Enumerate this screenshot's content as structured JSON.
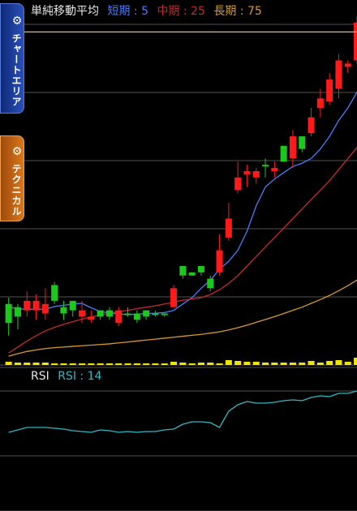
{
  "legend": {
    "title": "単純移動平均",
    "short": "短期 : 5",
    "mid": "中期 : 25",
    "long": "長期 : 75"
  },
  "rsi_legend": {
    "title": "RSI",
    "period": "RSI : 14"
  },
  "tabs": {
    "chart_area": "チャートエリア",
    "technical": "テクニカル"
  },
  "icons": {
    "tab_gear": "gear-icon"
  },
  "colors": {
    "up": "#1dc81d",
    "down": "#ff1a1a",
    "sma_short": "#4a7cff",
    "sma_mid": "#c62a2a",
    "sma_long": "#d79a2a",
    "rsi": "#35b7c0",
    "volume": "#f2e600",
    "price_line": "#f5b26b",
    "grid": "#505050"
  },
  "chart_data": [
    {
      "type": "candlestick",
      "title": "単純移動平均",
      "series_names": [
        "短期 : 5",
        "中期 : 25",
        "長期 : 75"
      ],
      "price_range": [
        0,
        100
      ],
      "grid": true,
      "candles": [
        {
          "o": 12,
          "h": 20,
          "l": 8,
          "c": 18
        },
        {
          "o": 14,
          "h": 18,
          "l": 10,
          "c": 17
        },
        {
          "o": 19,
          "h": 22,
          "l": 14,
          "c": 16
        },
        {
          "o": 19,
          "h": 21,
          "l": 13,
          "c": 16
        },
        {
          "o": 18,
          "h": 23,
          "l": 13,
          "c": 15
        },
        {
          "o": 19,
          "h": 25,
          "l": 18,
          "c": 24
        },
        {
          "o": 15,
          "h": 19,
          "l": 13,
          "c": 17
        },
        {
          "o": 16,
          "h": 19,
          "l": 14,
          "c": 19
        },
        {
          "o": 16,
          "h": 19,
          "l": 12,
          "c": 14
        },
        {
          "o": 14,
          "h": 16,
          "l": 12,
          "c": 13
        },
        {
          "o": 14,
          "h": 16,
          "l": 13,
          "c": 16
        },
        {
          "o": 14,
          "h": 17,
          "l": 13,
          "c": 16
        },
        {
          "o": 16,
          "h": 17,
          "l": 11,
          "c": 12
        },
        {
          "o": 15,
          "h": 17,
          "l": 14,
          "c": 15
        },
        {
          "o": 13,
          "h": 16,
          "l": 12,
          "c": 15
        },
        {
          "o": 14,
          "h": 16,
          "l": 13,
          "c": 16
        },
        {
          "o": 15,
          "h": 16,
          "l": 14,
          "c": 15
        },
        {
          "o": 15,
          "h": 15,
          "l": 14,
          "c": 15
        },
        {
          "o": 23,
          "h": 24,
          "l": 17,
          "c": 17
        },
        {
          "o": 27,
          "h": 30,
          "l": 26,
          "c": 30
        },
        {
          "o": 27,
          "h": 28,
          "l": 27,
          "c": 28
        },
        {
          "o": 28,
          "h": 30,
          "l": 27,
          "c": 30
        },
        {
          "o": 23,
          "h": 27,
          "l": 22,
          "c": 26
        },
        {
          "o": 35,
          "h": 40,
          "l": 27,
          "c": 28
        },
        {
          "o": 45,
          "h": 50,
          "l": 38,
          "c": 39
        },
        {
          "o": 58,
          "h": 63,
          "l": 53,
          "c": 54
        },
        {
          "o": 60,
          "h": 62,
          "l": 55,
          "c": 59
        },
        {
          "o": 60,
          "h": 61,
          "l": 56,
          "c": 58
        },
        {
          "o": 62,
          "h": 64,
          "l": 58,
          "c": 62
        },
        {
          "o": 61,
          "h": 63,
          "l": 58,
          "c": 60
        },
        {
          "o": 63,
          "h": 68,
          "l": 63,
          "c": 68
        },
        {
          "o": 71,
          "h": 73,
          "l": 61,
          "c": 64
        },
        {
          "o": 67,
          "h": 71,
          "l": 66,
          "c": 71
        },
        {
          "o": 77,
          "h": 80,
          "l": 71,
          "c": 72
        },
        {
          "o": 83,
          "h": 86,
          "l": 77,
          "c": 80
        },
        {
          "o": 89,
          "h": 91,
          "l": 81,
          "c": 82
        },
        {
          "o": 95,
          "h": 97,
          "l": 83,
          "c": 86
        },
        {
          "o": 94,
          "h": 95,
          "l": 91,
          "c": 93
        },
        {
          "o": 107,
          "h": 109,
          "l": 94,
          "c": 95
        },
        {
          "o": 106,
          "h": 109,
          "l": 100,
          "c": 108
        }
      ],
      "sma_short": [
        17,
        16.5,
        16.3,
        16.4,
        16.3,
        17.2,
        17.6,
        18,
        18.2,
        16.8,
        15.6,
        15.2,
        14.9,
        14.6,
        14.8,
        15,
        15.1,
        15.3,
        16,
        18,
        20,
        23,
        25.5,
        29,
        31.5,
        35,
        41,
        49,
        55,
        57.5,
        59.5,
        61.5,
        62.5,
        64,
        67,
        71,
        76,
        80,
        85,
        90
      ],
      "sma_mid": [
        2.5,
        4.4,
        6.3,
        8,
        9.5,
        10.6,
        11.6,
        12.4,
        13.2,
        13.9,
        14.5,
        15.1,
        15.6,
        16,
        16.5,
        17,
        17.4,
        18,
        18.6,
        19.2,
        19.6,
        20,
        21,
        22.5,
        24.5,
        27,
        30,
        33,
        36,
        39,
        42,
        45,
        48,
        51,
        54,
        57,
        60.5,
        64,
        67.5,
        71.2
      ],
      "sma_long": [
        1.5,
        2.3,
        3,
        3.5,
        3.9,
        4.2,
        4.4,
        4.6,
        4.8,
        5,
        5.2,
        5.4,
        5.7,
        6,
        6.3,
        6.6,
        6.9,
        7.2,
        7.5,
        7.8,
        8.1,
        8.4,
        8.8,
        9.2,
        9.8,
        10.5,
        11.3,
        12.2,
        13.1,
        14,
        15,
        16,
        17,
        18.2,
        19.4,
        20.7,
        22.2,
        23.8,
        25.6,
        27.5
      ],
      "volume": [
        2,
        1.5,
        1.5,
        1.5,
        1.5,
        1,
        1,
        1,
        1,
        1,
        1,
        1,
        1,
        1,
        1,
        1,
        1,
        1,
        2,
        1.5,
        1,
        1.5,
        1.5,
        1,
        3,
        2.5,
        2,
        2,
        1.5,
        1.5,
        1.5,
        1.5,
        1.5,
        2.5,
        1.5,
        2.5,
        3,
        2,
        4.5,
        2.5
      ],
      "price_level": 104
    },
    {
      "type": "line",
      "title": "RSI",
      "series": [
        {
          "name": "RSI : 14",
          "values": [
            32,
            35,
            38,
            38,
            38,
            37,
            36,
            34,
            33,
            32,
            35,
            34,
            32,
            33,
            32,
            33,
            33,
            35,
            36,
            42,
            45,
            45,
            44,
            38,
            58,
            66,
            70,
            68,
            68,
            69,
            71,
            72,
            71,
            75,
            77,
            76,
            80,
            80,
            83,
            73
          ]
        }
      ],
      "ylim": [
        0,
        100
      ],
      "grid": true
    }
  ]
}
